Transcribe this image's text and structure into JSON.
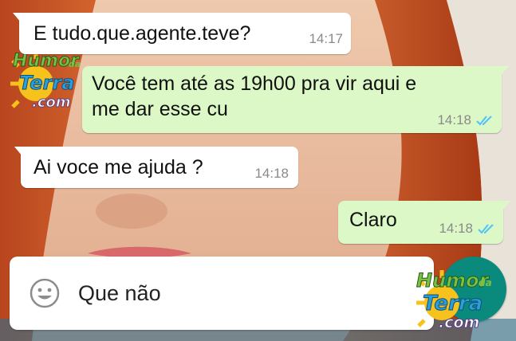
{
  "messages": [
    {
      "direction": "in",
      "text": "E tudo.que.agente.teve?",
      "time": "14:17"
    },
    {
      "direction": "out",
      "text_lines": [
        "Você tem até as 19h00 pra vir aqui e",
        "me dar esse cu"
      ],
      "time": "14:18",
      "status": "read"
    },
    {
      "direction": "in",
      "text": "Ai voce me ajuda ?",
      "time": "14:18"
    },
    {
      "direction": "out",
      "text": "Claro",
      "time": "14:18",
      "status": "read"
    }
  ],
  "composer": {
    "value": "Que não",
    "emoji_icon": "smiley-icon"
  },
  "watermark": {
    "line1": "Humor",
    "line2": "da",
    "line3": "Terra",
    "line4": ".com"
  },
  "colors": {
    "incoming_bubble": "#ffffff",
    "outgoing_bubble": "#dcf8c6",
    "read_ticks": "#4fc3f7",
    "send_button": "#0a8a7c"
  }
}
